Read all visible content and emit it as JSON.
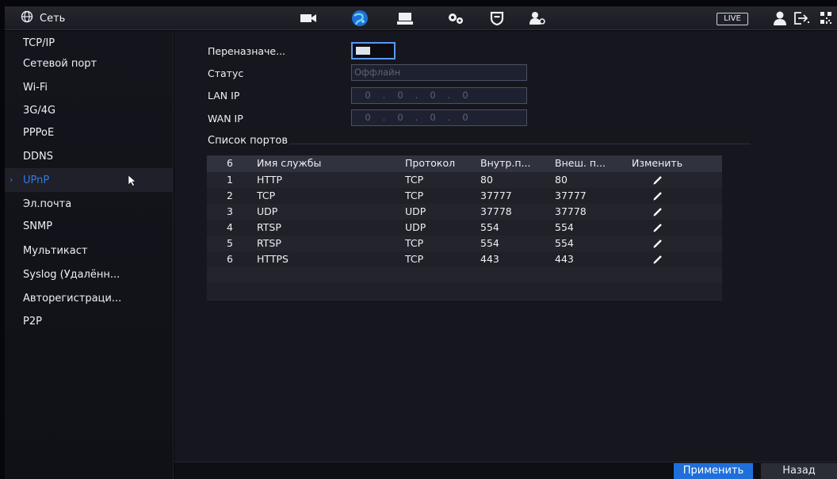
{
  "header": {
    "title": "Сеть",
    "icons": [
      "globe-icon",
      "camera-icon",
      "network-icon",
      "storage-icon",
      "settings-icon",
      "security-icon",
      "account-icon",
      "live-badge",
      "user-icon",
      "logout-icon",
      "qr-code-icon"
    ],
    "live_label": "LIVE"
  },
  "sidebar": {
    "items": [
      {
        "label": "TCP/IP"
      },
      {
        "label": "Сетевой порт"
      },
      {
        "label": "Wi-Fi"
      },
      {
        "label": "3G/4G"
      },
      {
        "label": "PPPoE"
      },
      {
        "label": "DDNS"
      },
      {
        "label": "UPnP",
        "active": true
      },
      {
        "label": "Эл.почта"
      },
      {
        "label": "SNMP"
      },
      {
        "label": "Мультикаст"
      },
      {
        "label": "Syslog (Удалённ..."
      },
      {
        "label": "Авторегистраци..."
      },
      {
        "label": "P2P"
      }
    ],
    "active_arrow": "›"
  },
  "form": {
    "port_mapping_label": "Переназначе...",
    "port_mapping_enabled": true,
    "status_label": "Статус",
    "status_value": "Оффлайн",
    "lan_ip_label": "LAN IP",
    "lan_ip": [
      "0",
      "0",
      "0",
      "0"
    ],
    "wan_ip_label": "WAN IP",
    "wan_ip": [
      "0",
      "0",
      "0",
      "0"
    ],
    "ip_separator": "."
  },
  "port_table": {
    "section_title": "Список портов",
    "columns": [
      "6",
      "Имя службы",
      "Протокол",
      "Внутр.п...",
      "Внеш. п...",
      "Изменить"
    ],
    "rows": [
      {
        "num": "1",
        "service": "HTTP",
        "protocol": "TCP",
        "internal": "80",
        "external": "80"
      },
      {
        "num": "2",
        "service": "TCP",
        "protocol": "TCP",
        "internal": "37777",
        "external": "37777"
      },
      {
        "num": "3",
        "service": "UDP",
        "protocol": "UDP",
        "internal": "37778",
        "external": "37778"
      },
      {
        "num": "4",
        "service": "RTSP",
        "protocol": "UDP",
        "internal": "554",
        "external": "554"
      },
      {
        "num": "5",
        "service": "RTSP",
        "protocol": "TCP",
        "internal": "554",
        "external": "554"
      },
      {
        "num": "6",
        "service": "HTTPS",
        "protocol": "TCP",
        "internal": "443",
        "external": "443"
      }
    ]
  },
  "buttons": {
    "apply": "Применить",
    "back": "Назад"
  },
  "colors": {
    "accent": "#1f6fda",
    "active_text": "#2e7de6",
    "panel": "#16171e",
    "sidebar": "#14151c"
  }
}
